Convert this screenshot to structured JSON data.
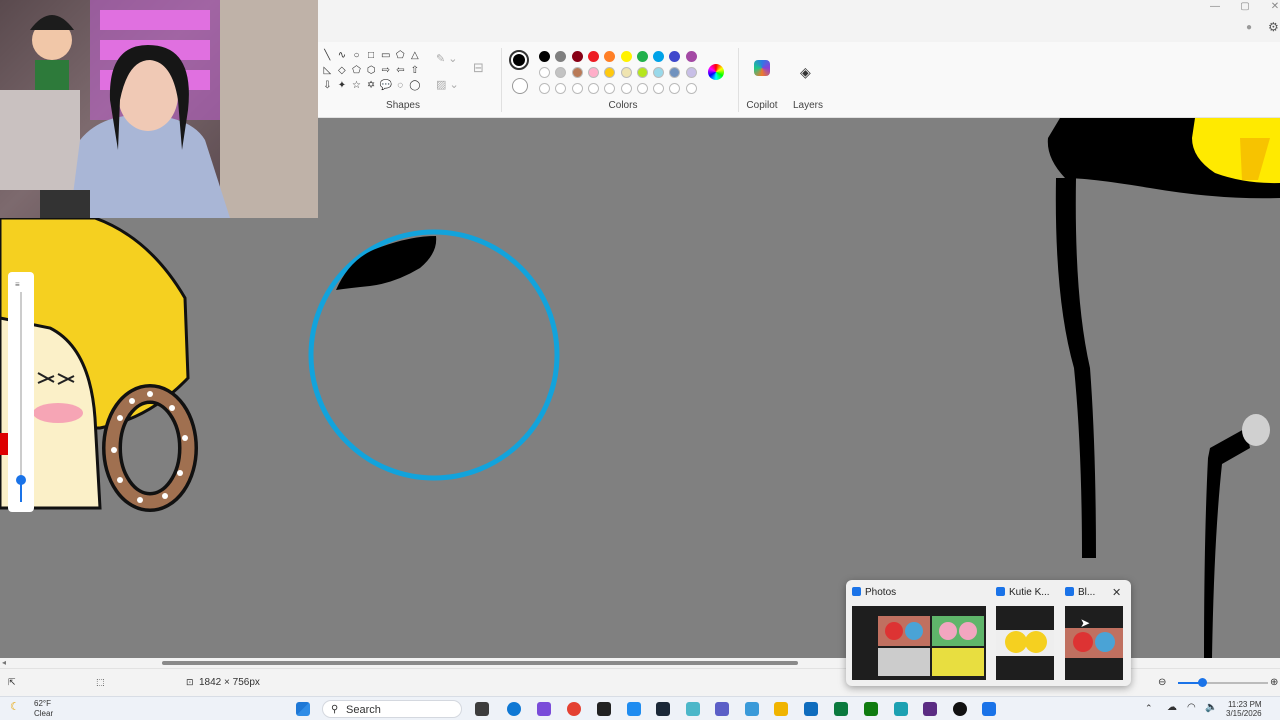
{
  "app": {
    "ribbon": {
      "shapes_label": "Shapes",
      "colors_label": "Colors",
      "copilot_label": "Copilot",
      "layers_label": "Layers"
    },
    "palette_row1": [
      "#000000",
      "#7f7f7f",
      "#880015",
      "#ed1c24",
      "#ff7f27",
      "#fff200",
      "#22b14c",
      "#00a2e8",
      "#3f48cc",
      "#a349a4"
    ],
    "palette_row2": [
      "#ffffff",
      "#c3c3c3",
      "#b97a57",
      "#ffaec9",
      "#ffc90e",
      "#efe4b0",
      "#b5e61d",
      "#99d9ea",
      "#7092be",
      "#c8bfe7"
    ],
    "current_color": "#000000",
    "canvas_bg": "#808080"
  },
  "status": {
    "canvas_size": "1842 × 756px"
  },
  "taskbar_preview": {
    "cards": [
      {
        "title": "Photos"
      },
      {
        "title": "Kutie K..."
      },
      {
        "title": "Bl..."
      }
    ],
    "close_label": "✕"
  },
  "taskbar": {
    "weather_temp": "62°F",
    "weather_desc": "Clear",
    "search_label": "Search",
    "time": "11:23 PM",
    "date": "3/15/2026"
  }
}
